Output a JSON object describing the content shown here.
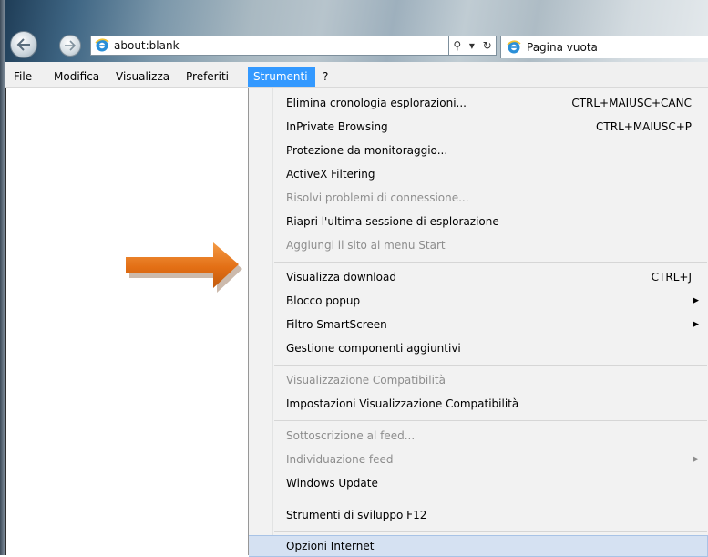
{
  "address_bar": {
    "url": "about:blank",
    "search_glyph": "⚲",
    "dropdown_glyph": "▾",
    "refresh_glyph": "↻"
  },
  "tab": {
    "title": "Pagina vuota"
  },
  "menubar": {
    "items": [
      {
        "label": "File"
      },
      {
        "label": "Modifica"
      },
      {
        "label": "Visualizza"
      },
      {
        "label": "Preferiti"
      },
      {
        "label": "Strumenti"
      },
      {
        "label": "?"
      }
    ],
    "active": "Strumenti"
  },
  "tools_menu": {
    "items": [
      {
        "label": "Elimina cronologia esplorazioni...",
        "shortcut": "CTRL+MAIUSC+CANC"
      },
      {
        "label": "InPrivate Browsing",
        "shortcut": "CTRL+MAIUSC+P"
      },
      {
        "label": "Protezione da monitoraggio..."
      },
      {
        "label": "ActiveX Filtering"
      },
      {
        "label": "Risolvi problemi di connessione...",
        "disabled": true
      },
      {
        "label": "Riapri l'ultima sessione di esplorazione"
      },
      {
        "label": "Aggiungi il sito al menu Start",
        "disabled": true
      },
      {
        "label": "Visualizza download",
        "shortcut": "CTRL+J"
      },
      {
        "label": "Blocco popup",
        "submenu": true
      },
      {
        "label": "Filtro SmartScreen",
        "submenu": true
      },
      {
        "label": "Gestione componenti aggiuntivi"
      },
      {
        "label": "Visualizzazione Compatibilità",
        "disabled": true
      },
      {
        "label": "Impostazioni Visualizzazione Compatibilità"
      },
      {
        "label": "Sottoscrizione al feed...",
        "disabled": true
      },
      {
        "label": "Individuazione feed",
        "disabled": true,
        "submenu": true
      },
      {
        "label": "Windows Update"
      },
      {
        "label": "Strumenti di sviluppo F12"
      },
      {
        "label": "Opzioni Internet",
        "highlighted": true
      }
    ],
    "submenu_glyph": "▶"
  },
  "colors": {
    "menu_active": "#3399ff",
    "arrow": "#e8771e",
    "highlight": "#d5e1f2"
  },
  "icons": {
    "back": "back-arrow-icon",
    "forward": "forward-arrow-icon",
    "page": "internet-explorer-icon",
    "annotation": "orange-arrow-icon"
  }
}
